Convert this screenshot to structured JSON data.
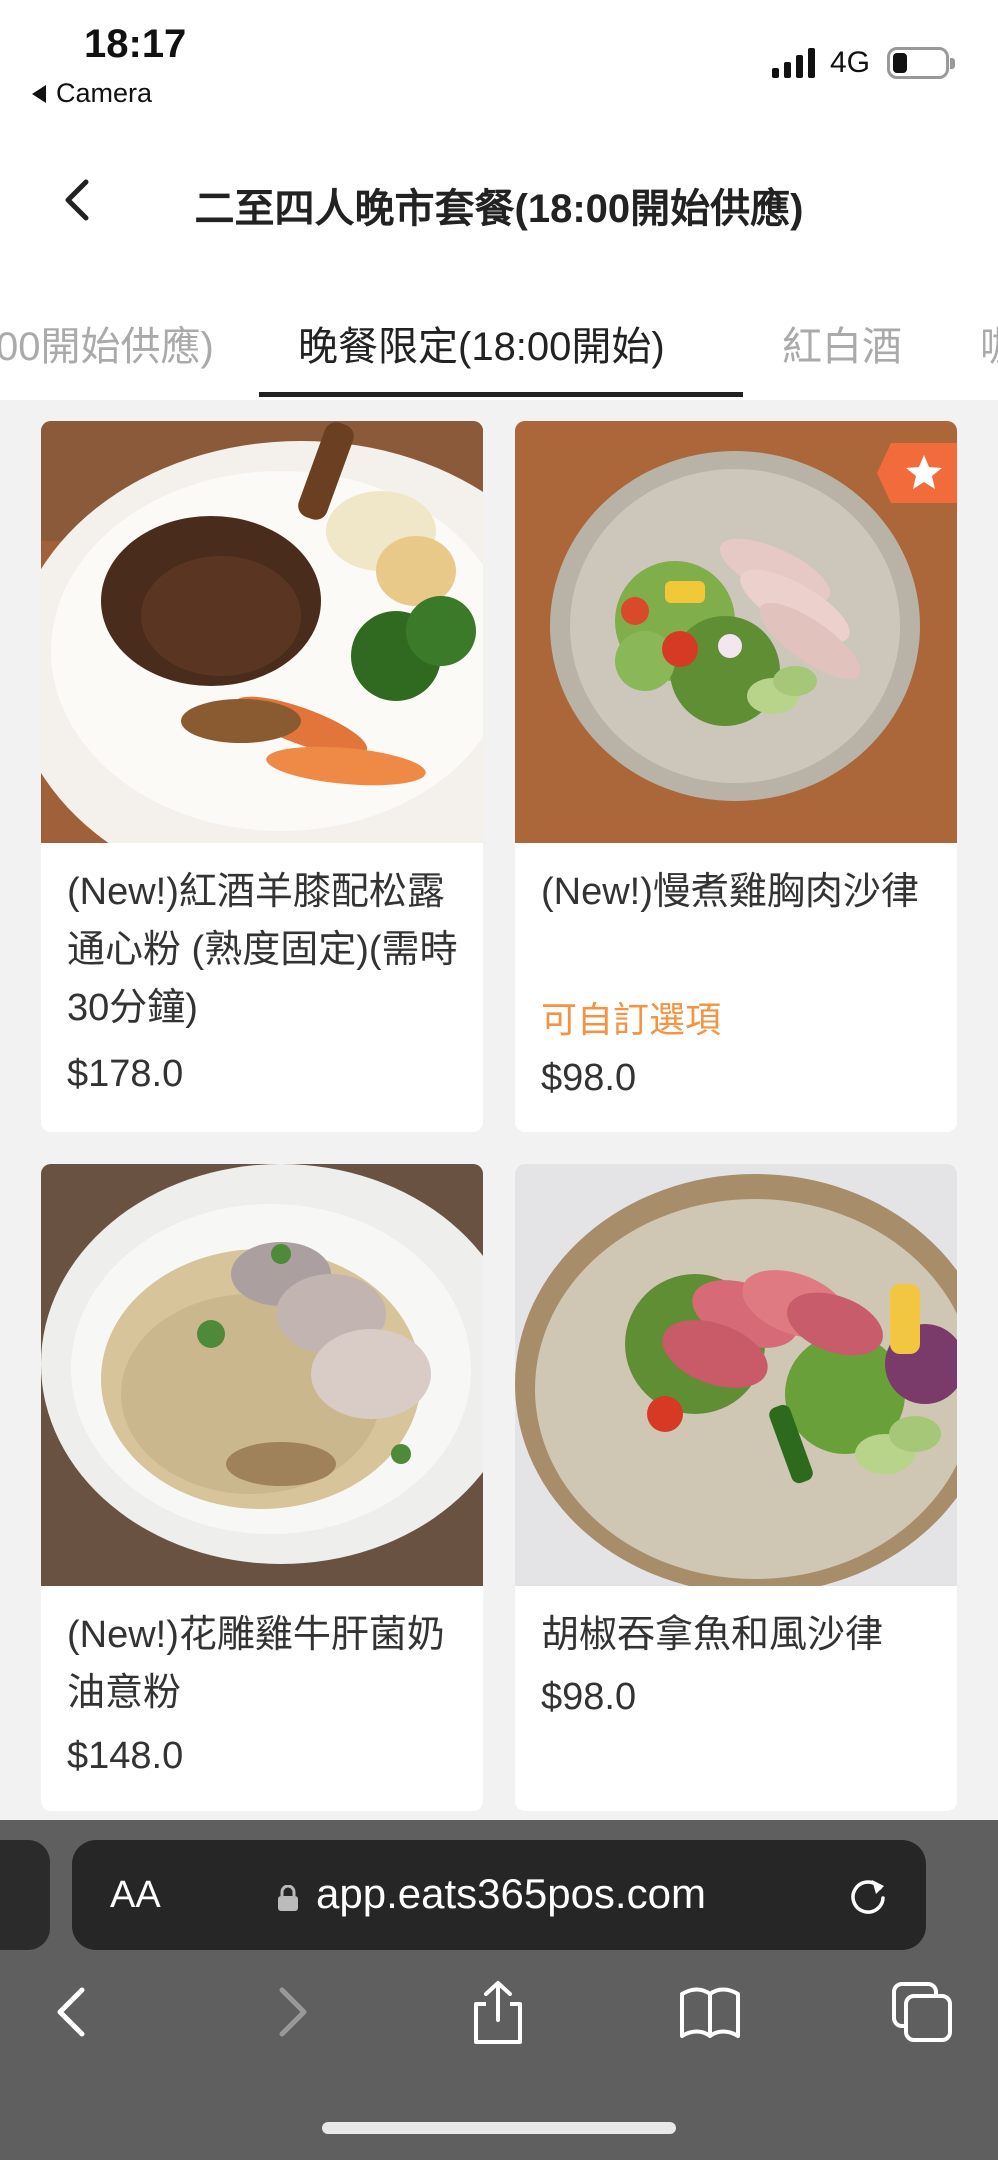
{
  "status": {
    "time": "18:17",
    "back_app": "Camera",
    "network": "4G"
  },
  "header": {
    "title": "二至四人晚市套餐(18:00開始供應)"
  },
  "tabs": [
    {
      "label": "00開始供應)"
    },
    {
      "label": "晚餐限定(18:00開始)"
    },
    {
      "label": "紅白酒"
    },
    {
      "label": "咖"
    }
  ],
  "items": [
    {
      "name": "(New!)紅酒羊膝配松露通心粉 (熟度固定)(需時30分鐘)",
      "option": "",
      "price": "$178.0"
    },
    {
      "name": "(New!)慢煮雞胸肉沙律",
      "option": "可自訂選項",
      "price": "$98.0"
    },
    {
      "name": "(New!)花雕雞牛肝菌奶油意粉",
      "option": "",
      "price": "$148.0"
    },
    {
      "name": "胡椒吞拿魚和風沙律",
      "option": "",
      "price": "$98.0"
    }
  ],
  "browser": {
    "text_size_label": "AA",
    "url": "app.eats365pos.com"
  },
  "colors": {
    "accent": "#f39343",
    "badge": "#f26b3a"
  }
}
